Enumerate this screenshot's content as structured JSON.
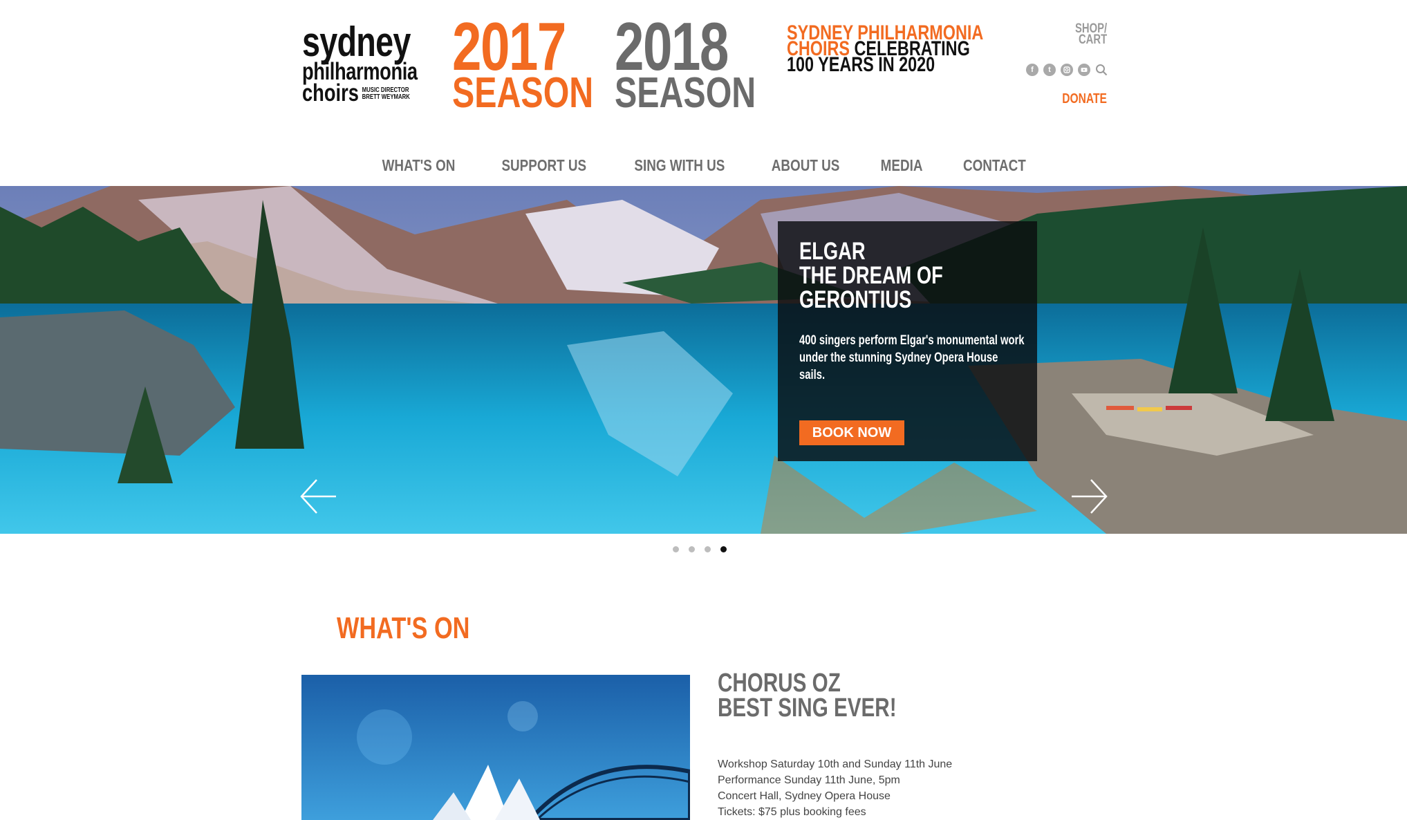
{
  "logo": {
    "line1": "sydney",
    "line2": "philharmonia",
    "line3": "choirs",
    "music_director": [
      "MUSIC DIRECTOR",
      "BRETT WEYMARK"
    ]
  },
  "seasons": [
    {
      "year": "2017",
      "label": "SEASON",
      "color": "#f26b21"
    },
    {
      "year": "2018",
      "label": "SEASON",
      "color": "#6b6b6b"
    }
  ],
  "celebration": {
    "line1": "SYDNEY PHILHARMONIA",
    "line2_orange": "CHOIRS",
    "line2_rest": " CELEBRATING",
    "line3": "100 YEARS IN 2020"
  },
  "header": {
    "shop_line1": "SHOP/",
    "shop_line2": "CART",
    "donate": "DONATE",
    "social_icons": [
      "facebook-icon",
      "twitter-icon",
      "instagram-icon",
      "youtube-icon",
      "search-icon"
    ]
  },
  "nav": [
    "WHAT'S ON",
    "SUPPORT US",
    "SING WITH US",
    "ABOUT US",
    "MEDIA",
    "CONTACT"
  ],
  "hero": {
    "title_lines": [
      "ELGAR",
      "THE DREAM OF",
      "GERONTIUS"
    ],
    "description": "400 singers perform Elgar's monumental work under the stunning Sydney Opera House sails.",
    "button": "BOOK NOW",
    "slide_count": 4,
    "active_slide": 4
  },
  "whats_on": {
    "heading": "WHAT'S ON",
    "event": {
      "title_line1": "CHORUS OZ",
      "title_line2": "BEST SING EVER!",
      "details": [
        "Workshop Saturday 10th and Sunday 11th June",
        "Performance Sunday 11th June, 5pm",
        "Concert Hall, Sydney Opera House",
        "Tickets: $75 plus booking fees"
      ]
    }
  },
  "colors": {
    "accent": "#f26b21",
    "grey": "#6b6b6b"
  }
}
